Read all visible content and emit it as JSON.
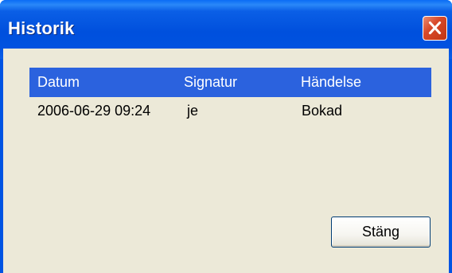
{
  "window": {
    "title": "Historik"
  },
  "icons": {
    "close": "close-icon"
  },
  "colors": {
    "titlebar": "#0054e3",
    "client_bg": "#ece9d8",
    "header_bg": "#2b62de",
    "close_button": "#d8492a"
  },
  "history": {
    "columns": [
      "Datum",
      "Signatur",
      "Händelse"
    ],
    "rows": [
      [
        "2006-06-29 09:24",
        "je",
        "Bokad"
      ]
    ]
  },
  "buttons": {
    "close_label": "Stäng"
  }
}
